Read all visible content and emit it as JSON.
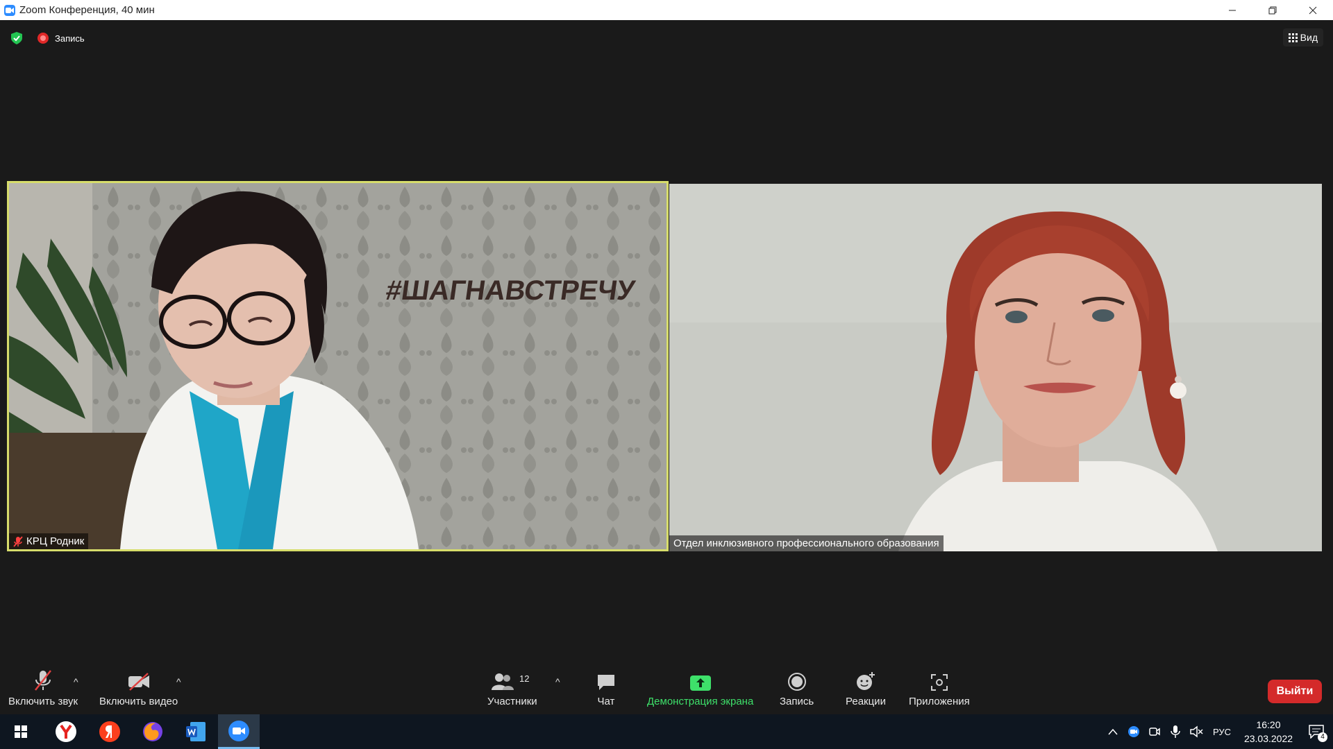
{
  "window": {
    "title": "Zoom Конференция, 40 мин"
  },
  "status": {
    "recording_label": "Запись",
    "view_label": "Вид"
  },
  "tiles": [
    {
      "name": "КРЦ Родник",
      "muted": true,
      "active_speaker": true,
      "wall_text": "#ШАГНАВСТРЕЧУ"
    },
    {
      "name": "Отдел инклюзивного профессионального образования",
      "muted": false,
      "active_speaker": false
    }
  ],
  "toolbar": {
    "audio_label": "Включить звук",
    "video_label": "Включить видео",
    "participants_label": "Участники",
    "participants_count": "12",
    "chat_label": "Чат",
    "share_label": "Демонстрация экрана",
    "record_label": "Запись",
    "reactions_label": "Реакции",
    "apps_label": "Приложения",
    "leave_label": "Выйти"
  },
  "taskbar": {
    "apps": [
      "windows-start",
      "yandex-browser",
      "yandex",
      "firefox",
      "word",
      "zoom"
    ],
    "language": "РУС",
    "time": "16:20",
    "date": "23.03.2022",
    "notifications_count": "4"
  },
  "colors": {
    "accent_share": "#3ee06a",
    "leave": "#d42a2a",
    "speaker_border": "#d7dd6b",
    "zoom_blue": "#2d8cff"
  }
}
